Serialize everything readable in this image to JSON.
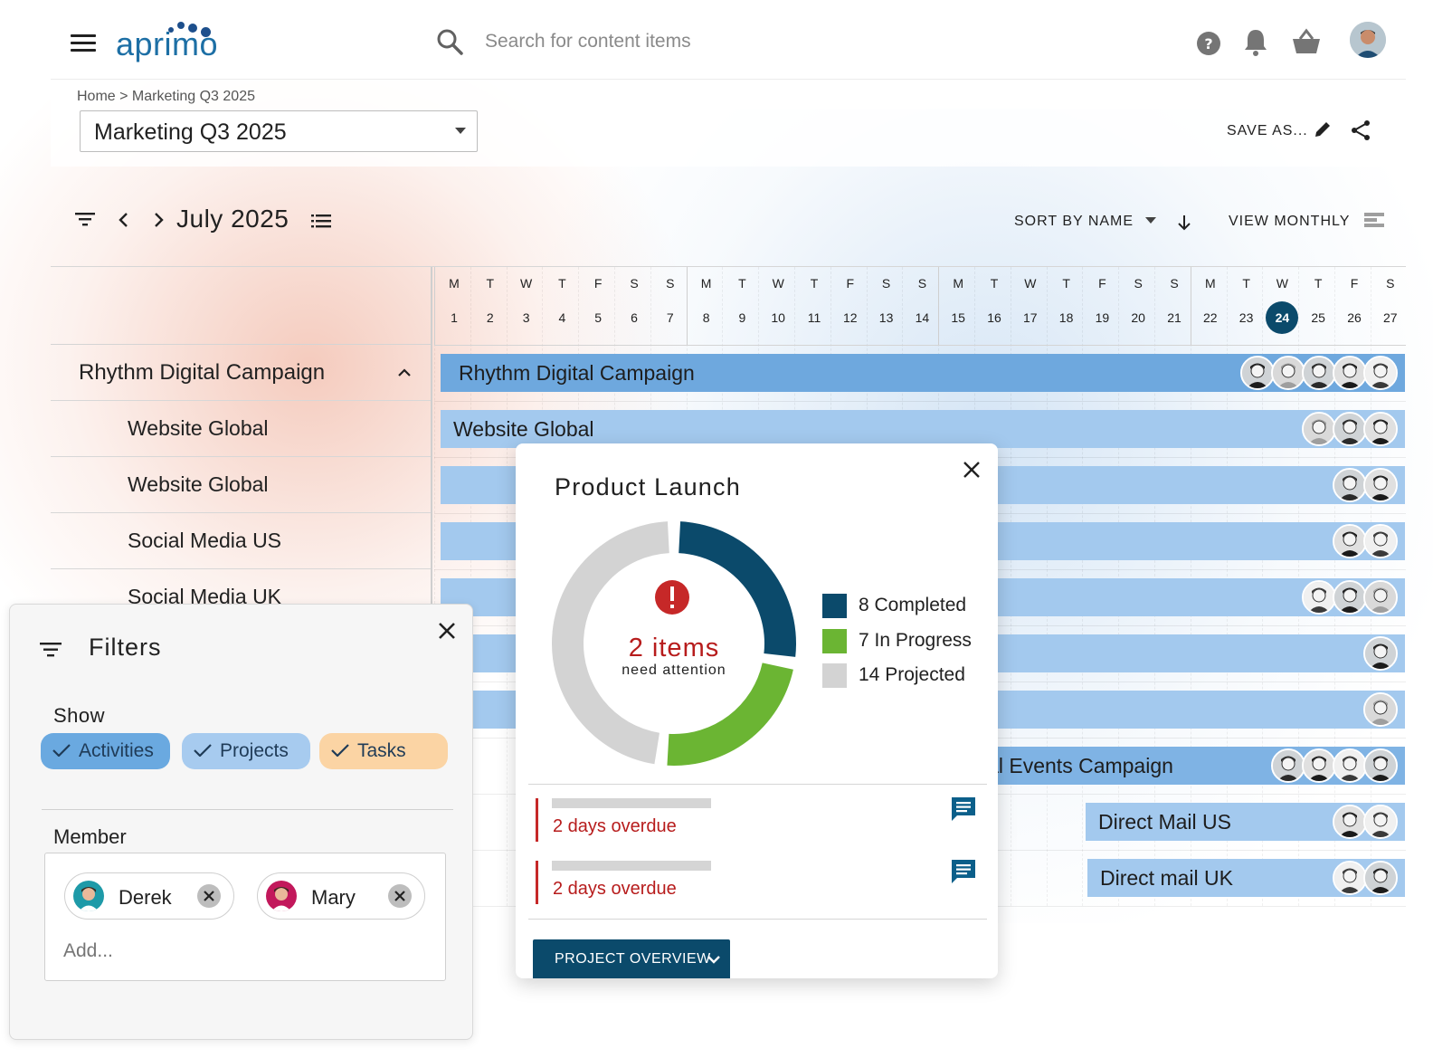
{
  "app": {
    "logo_text": "aprimo"
  },
  "search": {
    "placeholder": "Search for content items"
  },
  "header": {
    "breadcrumb": "Home > Marketing Q3 2025",
    "project_select": "Marketing Q3 2025",
    "save_as": "SAVE AS..."
  },
  "toolbar": {
    "month": "July 2025",
    "sort_by": "SORT BY NAME",
    "view": "VIEW MONTHLY"
  },
  "calendar": {
    "weekdays": [
      "M",
      "T",
      "W",
      "T",
      "F",
      "S",
      "S",
      "M",
      "T",
      "W",
      "T",
      "F",
      "S",
      "S",
      "M",
      "T",
      "W",
      "T",
      "F",
      "S",
      "S",
      "M",
      "T",
      "W",
      "T",
      "F",
      "S"
    ],
    "days": [
      "1",
      "2",
      "3",
      "4",
      "5",
      "6",
      "7",
      "8",
      "9",
      "10",
      "11",
      "12",
      "13",
      "14",
      "15",
      "16",
      "17",
      "18",
      "19",
      "20",
      "21",
      "22",
      "23",
      "24",
      "25",
      "26",
      "27"
    ],
    "today": "24"
  },
  "rows": {
    "labels": [
      {
        "text": "Rhythm Digital Campaign",
        "kind": "parent"
      },
      {
        "text": "Website Global",
        "kind": "child"
      },
      {
        "text": "Website Global",
        "kind": "child"
      },
      {
        "text": "Social Media US",
        "kind": "child"
      },
      {
        "text": "Social Media UK",
        "kind": "child"
      }
    ],
    "bars": [
      {
        "label": "Rhythm Digital Campaign",
        "avatars": 5,
        "kind": "parent"
      },
      {
        "label": "Website Global",
        "avatars": 3,
        "kind": "child"
      },
      {
        "label": "",
        "avatars": 2,
        "kind": "child"
      },
      {
        "label": "",
        "avatars": 2,
        "kind": "child"
      },
      {
        "label": "",
        "avatars": 3,
        "kind": "child"
      },
      {
        "label": "",
        "avatars": 1,
        "kind": "child"
      },
      {
        "label": "",
        "avatars": 1,
        "kind": "child"
      },
      {
        "label": "Local Events Campaign",
        "avatars": 4,
        "kind": "parent"
      },
      {
        "label": "Direct Mail US",
        "avatars": 2,
        "kind": "child"
      },
      {
        "label": "Direct mail UK",
        "avatars": 2,
        "kind": "child"
      }
    ]
  },
  "filters": {
    "title": "Filters",
    "show_label": "Show",
    "chips": [
      {
        "label": "Activities",
        "color": "#6aa9e0"
      },
      {
        "label": "Projects",
        "color": "#a7cbef"
      },
      {
        "label": "Tasks",
        "color": "#fbd4a4"
      }
    ],
    "member_label": "Member",
    "members": [
      {
        "name": "Derek",
        "color": "#1e9aa8"
      },
      {
        "name": "Mary",
        "color": "#c2185b"
      }
    ],
    "add_placeholder": "Add..."
  },
  "popup": {
    "title": "Product Launch",
    "attention_count": "2 items",
    "attention_sub": "need attention",
    "legend": [
      {
        "label": "8 Completed",
        "value": 8,
        "color": "#0b4a6b"
      },
      {
        "label": "7 In Progress",
        "value": 7,
        "color": "#6bb533"
      },
      {
        "label": "14 Projected",
        "value": 14,
        "color": "#d3d3d3"
      }
    ],
    "tasks": [
      {
        "status": "2 days overdue"
      },
      {
        "status": "2 days overdue"
      }
    ],
    "overview_button": "PROJECT OVERVIEW"
  },
  "colors": {
    "accent": "#0b4a6b",
    "overdue": "#b71c1c",
    "bar_parent": "#6ea8de",
    "bar_child": "#a3c9ee"
  }
}
